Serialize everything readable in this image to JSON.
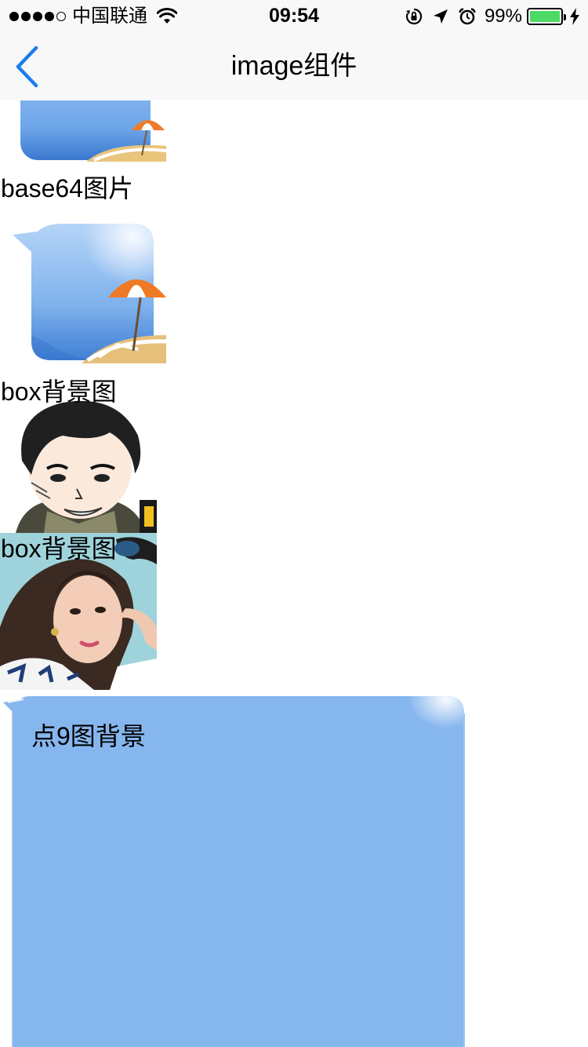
{
  "status_bar": {
    "carrier": "中国联通",
    "time": "09:54",
    "battery_percent": "99%",
    "battery_level": 0.99,
    "icons": [
      "signal-dots-icon",
      "wifi-icon",
      "orientation-lock-icon",
      "location-arrow-icon",
      "alarm-icon",
      "battery-icon",
      "charging-icon"
    ]
  },
  "nav": {
    "back_icon": "chevron-left-icon",
    "title": "image组件"
  },
  "content": {
    "base64_label": "base64图片",
    "box_bg_label_1": "box背景图",
    "box_bg_label_2": "box背景图",
    "nine_patch_label": "点9图背景"
  },
  "colors": {
    "accent_blue": "#1a7cf0",
    "bubble_blue": "#86b6ee",
    "battery_green": "#4cd964",
    "bar_bg": "#f8f8f8"
  }
}
